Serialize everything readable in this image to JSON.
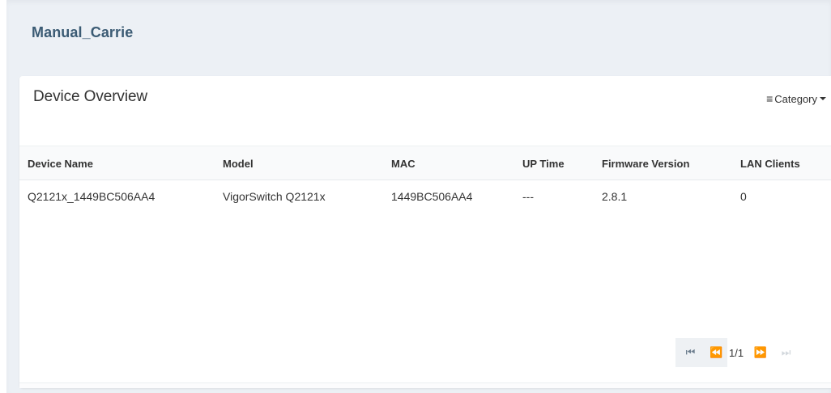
{
  "page": {
    "title": "Manual_Carrie"
  },
  "card": {
    "title": "Device Overview",
    "category_label": "Category",
    "menu_icon": "≡"
  },
  "table": {
    "columns": [
      "Device Name",
      "Model",
      "MAC",
      "UP Time",
      "Firmware Version",
      "LAN Clients"
    ],
    "rows": [
      [
        "Q2121x_1449BC506AA4",
        "VigorSwitch Q2121x",
        "1449BC506AA4",
        "---",
        "2.8.1",
        "0"
      ]
    ]
  },
  "pagination": {
    "page_text": "1/1",
    "first_icon": "⏮",
    "prev_icon": "⏪",
    "next_icon": "⏩",
    "last_icon": "⏭"
  },
  "colors": {
    "title_blue": "#3b5b74",
    "shell_bg": "#ecf0f5",
    "header_bg": "#f9fafb"
  }
}
